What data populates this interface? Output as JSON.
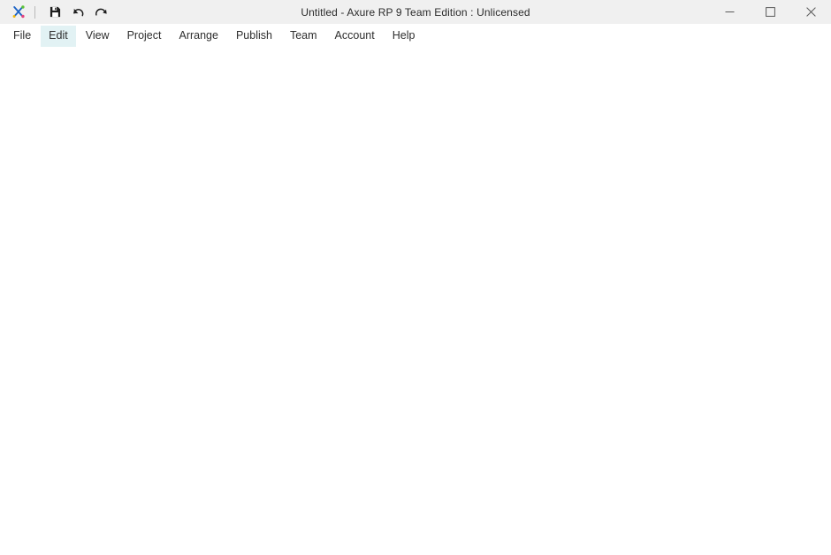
{
  "window": {
    "title": "Untitled - Axure RP 9 Team Edition : Unlicensed",
    "minimize_label": "Minimize",
    "maximize_label": "Maximize",
    "close_label": "Close",
    "titlebar_bg": "#f0f0f0",
    "body_bg": "#ffffff"
  },
  "toolbar": {
    "logo_name": "axure-logo",
    "logo_colors": {
      "blue": "#1a7ee0",
      "dark_blue": "#1b4fa8",
      "green": "#5bc236",
      "pink": "#e5437f",
      "yellow": "#f2b705"
    },
    "buttons": [
      {
        "name": "save",
        "label": "Save",
        "icon": "save-icon"
      },
      {
        "name": "undo",
        "label": "Undo",
        "icon": "undo-icon"
      },
      {
        "name": "redo",
        "label": "Redo",
        "icon": "redo-icon"
      }
    ]
  },
  "menu": {
    "highlight_color": "#e2f2f4",
    "active_item": "Edit",
    "items": [
      {
        "label": "File",
        "name": "menu-file"
      },
      {
        "label": "Edit",
        "name": "menu-edit"
      },
      {
        "label": "View",
        "name": "menu-view"
      },
      {
        "label": "Project",
        "name": "menu-project"
      },
      {
        "label": "Arrange",
        "name": "menu-arrange"
      },
      {
        "label": "Publish",
        "name": "menu-publish"
      },
      {
        "label": "Team",
        "name": "menu-team"
      },
      {
        "label": "Account",
        "name": "menu-account"
      },
      {
        "label": "Help",
        "name": "menu-help"
      }
    ]
  },
  "canvas": {
    "content": "",
    "background": "#ffffff"
  }
}
